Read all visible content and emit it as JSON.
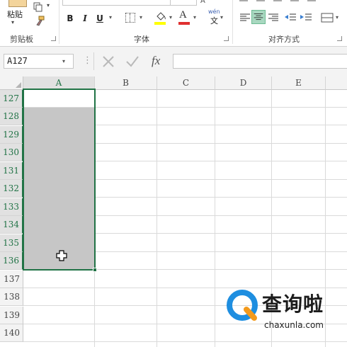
{
  "ribbon": {
    "clipboard": {
      "paste_label": "粘贴",
      "group_label": "剪贴板"
    },
    "font": {
      "group_label": "字体",
      "bold": "B",
      "italic": "I",
      "underline": "U",
      "font_color_glyph": "A",
      "fill_color": "#ffff00",
      "font_color": "#e03030",
      "phonetic_top": "wén",
      "phonetic_bottom": "文"
    },
    "alignment": {
      "group_label": "对齐方式",
      "active_color": "#a8d8c0"
    }
  },
  "formula_bar": {
    "name_box_value": "A127",
    "fx_label": "fx",
    "formula_value": ""
  },
  "sheet": {
    "accent_color": "#217346",
    "columns": [
      "A",
      "B",
      "C",
      "D",
      "E"
    ],
    "selected_column": "A",
    "rows": [
      "127",
      "128",
      "129",
      "130",
      "131",
      "132",
      "133",
      "134",
      "135",
      "136",
      "137",
      "138",
      "139",
      "140"
    ],
    "selection": "A127:A136",
    "active_cell": "A127"
  },
  "watermark": {
    "text": "查询啦",
    "url": "chaxunla.com",
    "color": "#1e8ee0"
  }
}
